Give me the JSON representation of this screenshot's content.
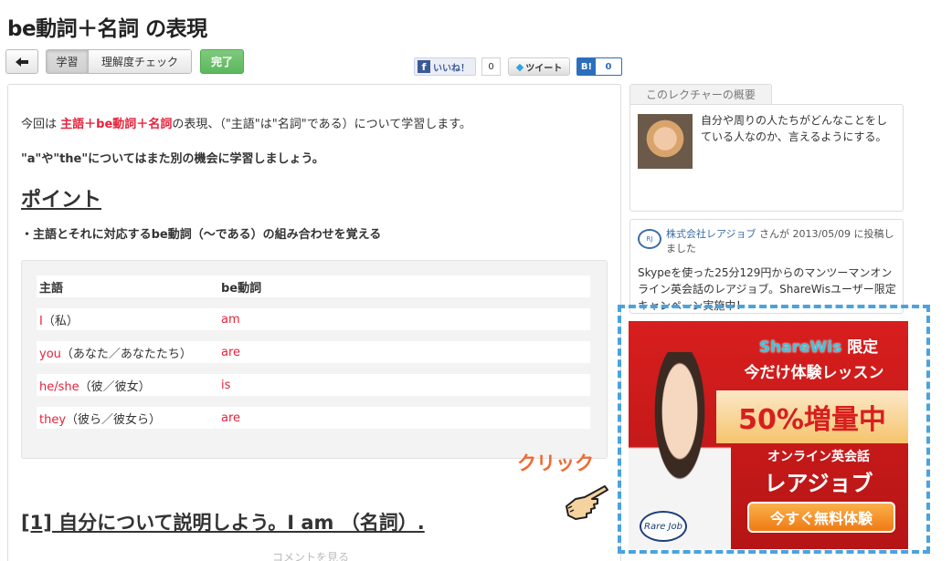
{
  "page_title": "be動詞＋名詞 の表現",
  "toolbar": {
    "back_icon": "arrow-left-icon",
    "learn_label": "学習",
    "check_label": "理解度チェック",
    "done_label": "完了"
  },
  "social": {
    "like_label": "いいね！",
    "like_count": "0",
    "tweet_label": "ツイート",
    "hatena_label": "B!",
    "hatena_count": "0"
  },
  "content": {
    "intro_prefix": "今回は ",
    "intro_subject": "主語",
    "intro_plus1": "＋",
    "intro_be": "be動詞",
    "intro_plus2": "＋",
    "intro_noun": "名詞",
    "intro_suffix": "の表現、（\"主語\"は\"名詞\"である）について学習します。",
    "note": "\"a\"や\"the\"についてはまた別の機会に学習しましょう。",
    "point_heading": "ポイント",
    "bullet": "・主語とそれに対応するbe動詞（〜である）の組み合わせを覚える",
    "table": {
      "headers": [
        "主語",
        "be動詞"
      ],
      "rows": [
        {
          "subject": "I",
          "subject_jp": "（私）",
          "be": "am"
        },
        {
          "subject": "you",
          "subject_jp": "（あなた／あなたたち）",
          "be": "are"
        },
        {
          "subject": "he/she",
          "subject_jp": "（彼／彼女）",
          "be": "is"
        },
        {
          "subject": "they",
          "subject_jp": "（彼ら／彼女ら）",
          "be": "are"
        }
      ]
    },
    "section1_heading": "[1] 自分について説明しよう。I am （名詞）.",
    "comment_link": "コメントを見る"
  },
  "sidebar": {
    "overview_tab": "このレクチャーの概要",
    "overview_text": "自分や周りの人たちがどんなことをしている人なのか、言えるようにする。",
    "post_company": "株式会社レアジョブ",
    "post_meta": " さんが 2013/05/09 に投稿しました",
    "post_body": "Skypeを使った25分129円からのマンツーマンオンライン英会話のレアジョブ。ShareWisユーザー限定キャンペーン実施中！"
  },
  "ad": {
    "brand": "ShareWis",
    "brand_suffix": " 限定",
    "sub": "今だけ体験レッスン",
    "band": "50%増量中",
    "line1": "オンライン英会話",
    "line2": "レアジョブ",
    "cta": "今すぐ無料体験",
    "logo": "Rare Job"
  },
  "annotation": {
    "click_label": "クリック"
  },
  "colors": {
    "accent_red": "#e6223c",
    "done_green": "#5cb85c",
    "ad_outline": "#4aa3df",
    "click_orange": "#f06a32"
  }
}
